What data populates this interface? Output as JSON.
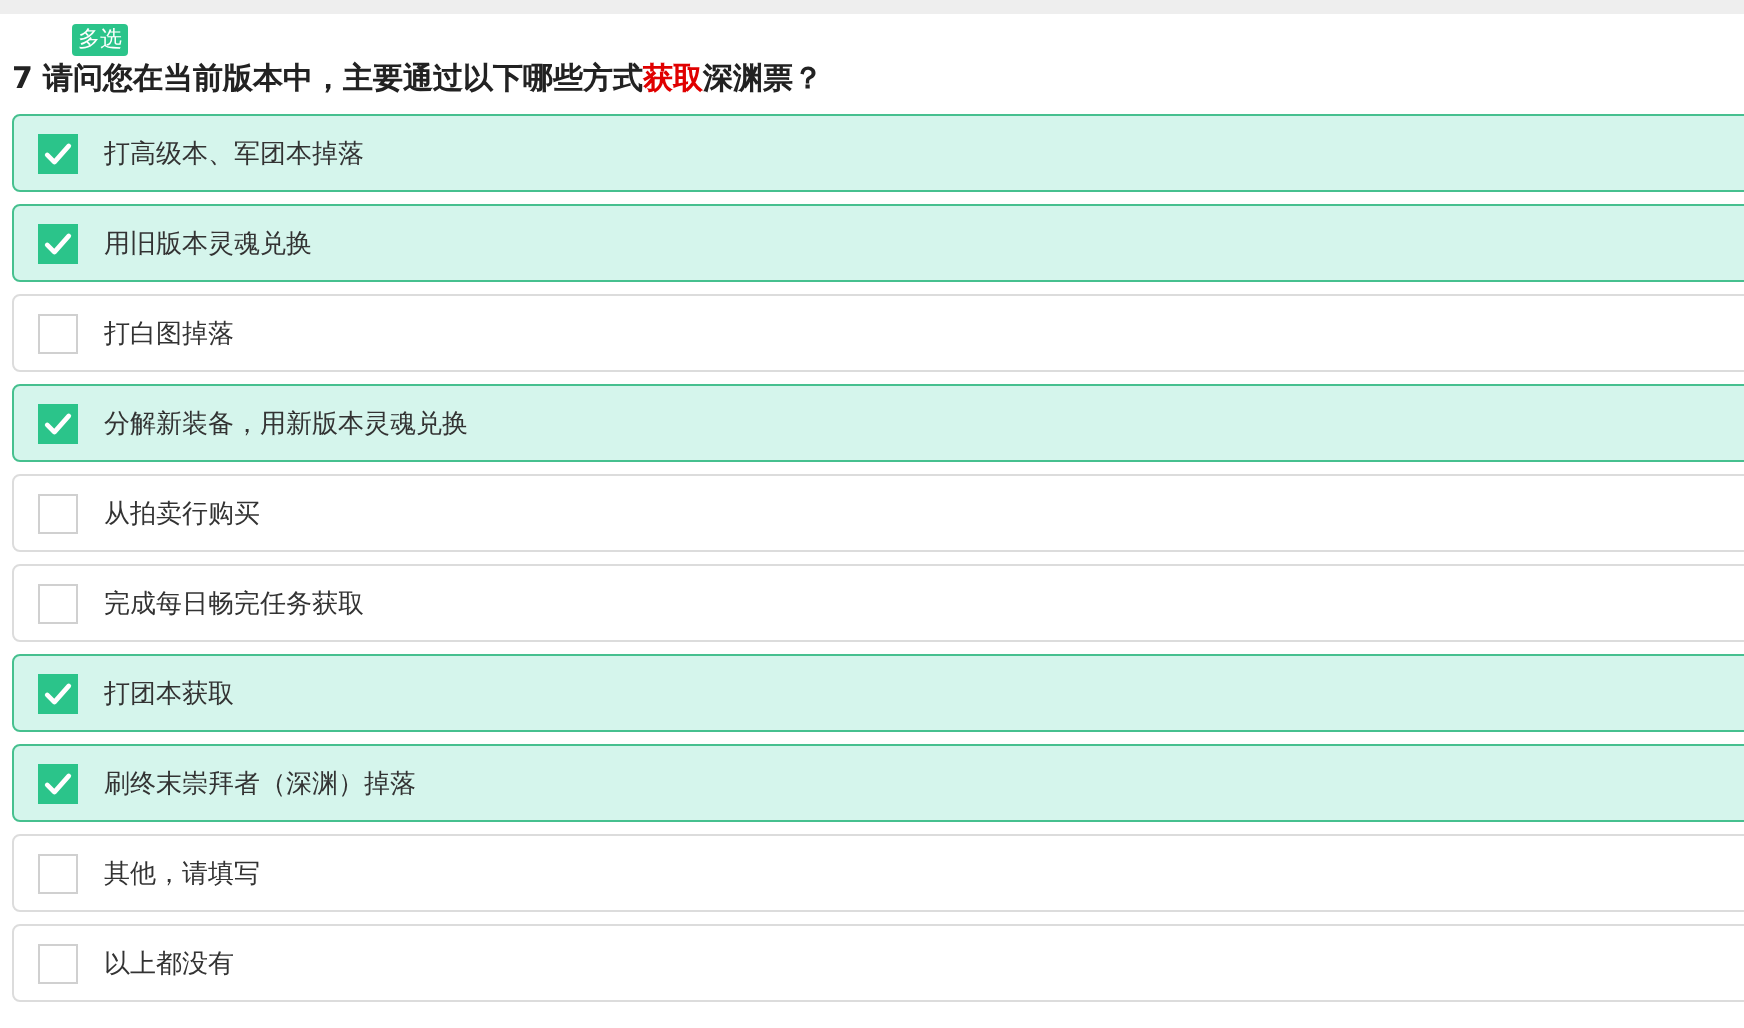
{
  "badge": "多选",
  "question": {
    "number": "7",
    "parts": [
      {
        "text": "请问您在当前版本中，主要通过以下哪些方式",
        "emphasis": false
      },
      {
        "text": "获取",
        "emphasis": true
      },
      {
        "text": "深渊票？",
        "emphasis": false
      }
    ]
  },
  "options": [
    {
      "label": "打高级本、军团本掉落",
      "checked": true
    },
    {
      "label": "用旧版本灵魂兑换",
      "checked": true
    },
    {
      "label": "打白图掉落",
      "checked": false
    },
    {
      "label": "分解新装备，用新版本灵魂兑换",
      "checked": true
    },
    {
      "label": "从拍卖行购买",
      "checked": false
    },
    {
      "label": "完成每日畅完任务获取",
      "checked": false
    },
    {
      "label": "打团本获取",
      "checked": true
    },
    {
      "label": "刷终末崇拜者（深渊）掉落",
      "checked": true
    },
    {
      "label": "其他，请填写",
      "checked": false
    },
    {
      "label": "以上都没有",
      "checked": false
    }
  ]
}
